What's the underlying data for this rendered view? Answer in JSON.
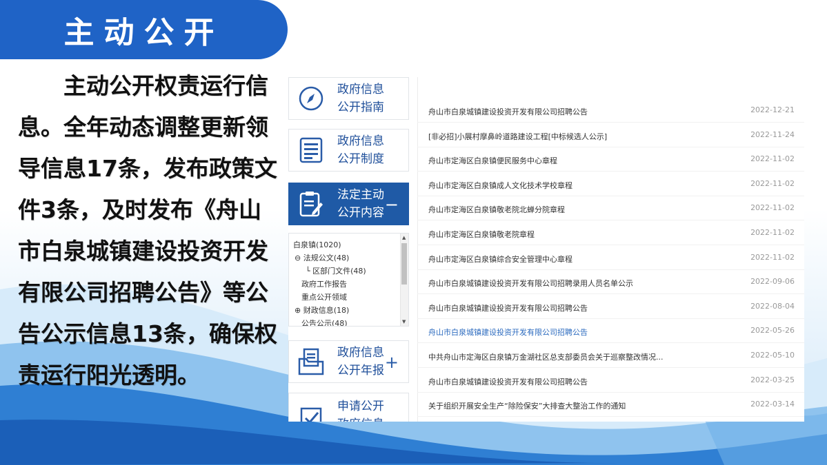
{
  "header": {
    "title": "主动公开"
  },
  "body": {
    "paragraph": "主动公开权责运行信息。全年动态调整更新领导信息17条，发布政策文件3条，及时发布《舟山市白泉城镇建设投资开发有限公司招聘公告》等公告公示信息13条，确保权责运行阳光透明。"
  },
  "sidebar": {
    "cards": [
      {
        "label": "政府信息公开指南",
        "icon": "compass-icon"
      },
      {
        "label": "政府信息公开制度",
        "icon": "document-list-icon"
      },
      {
        "label": "法定主动公开内容",
        "icon": "clipboard-edit-icon",
        "toggle": "−"
      },
      {
        "label": "政府信息公开年报",
        "icon": "folder-document-icon",
        "toggle": "+"
      },
      {
        "label": "申请公开政府信息",
        "icon": "checkbox-icon"
      }
    ],
    "tree": [
      "白泉镇(1020)",
      "⊖ 法规公文(48)",
      "└ 区部门文件(48)",
      "政府工作报告",
      "重点公开领域",
      "⊕ 财政信息(18)",
      "公告公示(48)"
    ]
  },
  "list": [
    {
      "title": "舟山市白泉城镇建设投资开发有限公司招聘公告",
      "date": "2022-12-21",
      "link": false
    },
    {
      "title": "[非必招]小展村摩鼻岭道路建设工程[中标候选人公示]",
      "date": "2022-11-24",
      "link": false
    },
    {
      "title": "舟山市定海区白泉镇便民服务中心章程",
      "date": "2022-11-02",
      "link": false
    },
    {
      "title": "舟山市定海区白泉镇成人文化技术学校章程",
      "date": "2022-11-02",
      "link": false
    },
    {
      "title": "舟山市定海区白泉镇敬老院北蝉分院章程",
      "date": "2022-11-02",
      "link": false
    },
    {
      "title": "舟山市定海区白泉镇敬老院章程",
      "date": "2022-11-02",
      "link": false
    },
    {
      "title": "舟山市定海区白泉镇综合安全管理中心章程",
      "date": "2022-11-02",
      "link": false
    },
    {
      "title": "舟山市白泉城镇建设投资开发有限公司招聘录用人员名单公示",
      "date": "2022-09-06",
      "link": false
    },
    {
      "title": "舟山市白泉城镇建设投资开发有限公司招聘公告",
      "date": "2022-08-04",
      "link": false
    },
    {
      "title": "舟山市白泉城镇建设投资开发有限公司招聘公告",
      "date": "2022-05-26",
      "link": true
    },
    {
      "title": "中共舟山市定海区白泉镇万金湖社区总支部委员会关于巡察整改情况...",
      "date": "2022-05-10",
      "link": false
    },
    {
      "title": "舟山市白泉城镇建设投资开发有限公司招聘公告",
      "date": "2022-03-25",
      "link": false
    },
    {
      "title": "关于组织开展安全生产“除险保安”大排查大整治工作的通知",
      "date": "2022-03-14",
      "link": false
    }
  ],
  "colors": {
    "brand": "#1f63c6",
    "nav_active": "#1f5aa6",
    "nav_text": "#1f4f9a"
  }
}
